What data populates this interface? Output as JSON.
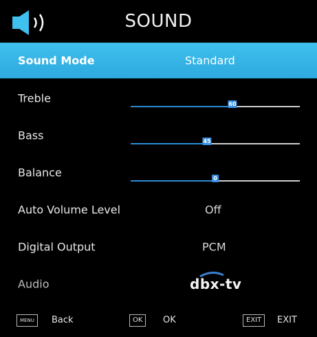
{
  "header": {
    "title": "SOUND",
    "icon": "speaker-icon"
  },
  "menu": {
    "sound_mode": {
      "label": "Sound Mode",
      "value": "Standard"
    },
    "treble": {
      "label": "Treble",
      "value": 60,
      "display": "60"
    },
    "bass": {
      "label": "Bass",
      "value": 45,
      "display": "45"
    },
    "balance": {
      "label": "Balance",
      "value": 0,
      "display": "0"
    },
    "auto_volume": {
      "label": "Auto Volume Level",
      "value": "Off"
    },
    "digital_output": {
      "label": "Digital Output",
      "value": "PCM"
    },
    "audio": {
      "label": "Audio",
      "value": "dbx-tv"
    }
  },
  "footer": {
    "menu_key": "MENU",
    "menu_text": "Back",
    "ok_key": "OK",
    "ok_text": "OK",
    "exit_key": "EXIT",
    "exit_text": "EXIT"
  },
  "colors": {
    "highlight": "#2da9de",
    "slider_fill": "#2a8cd6",
    "knob": "#3a8fe0",
    "background": "#000000"
  }
}
